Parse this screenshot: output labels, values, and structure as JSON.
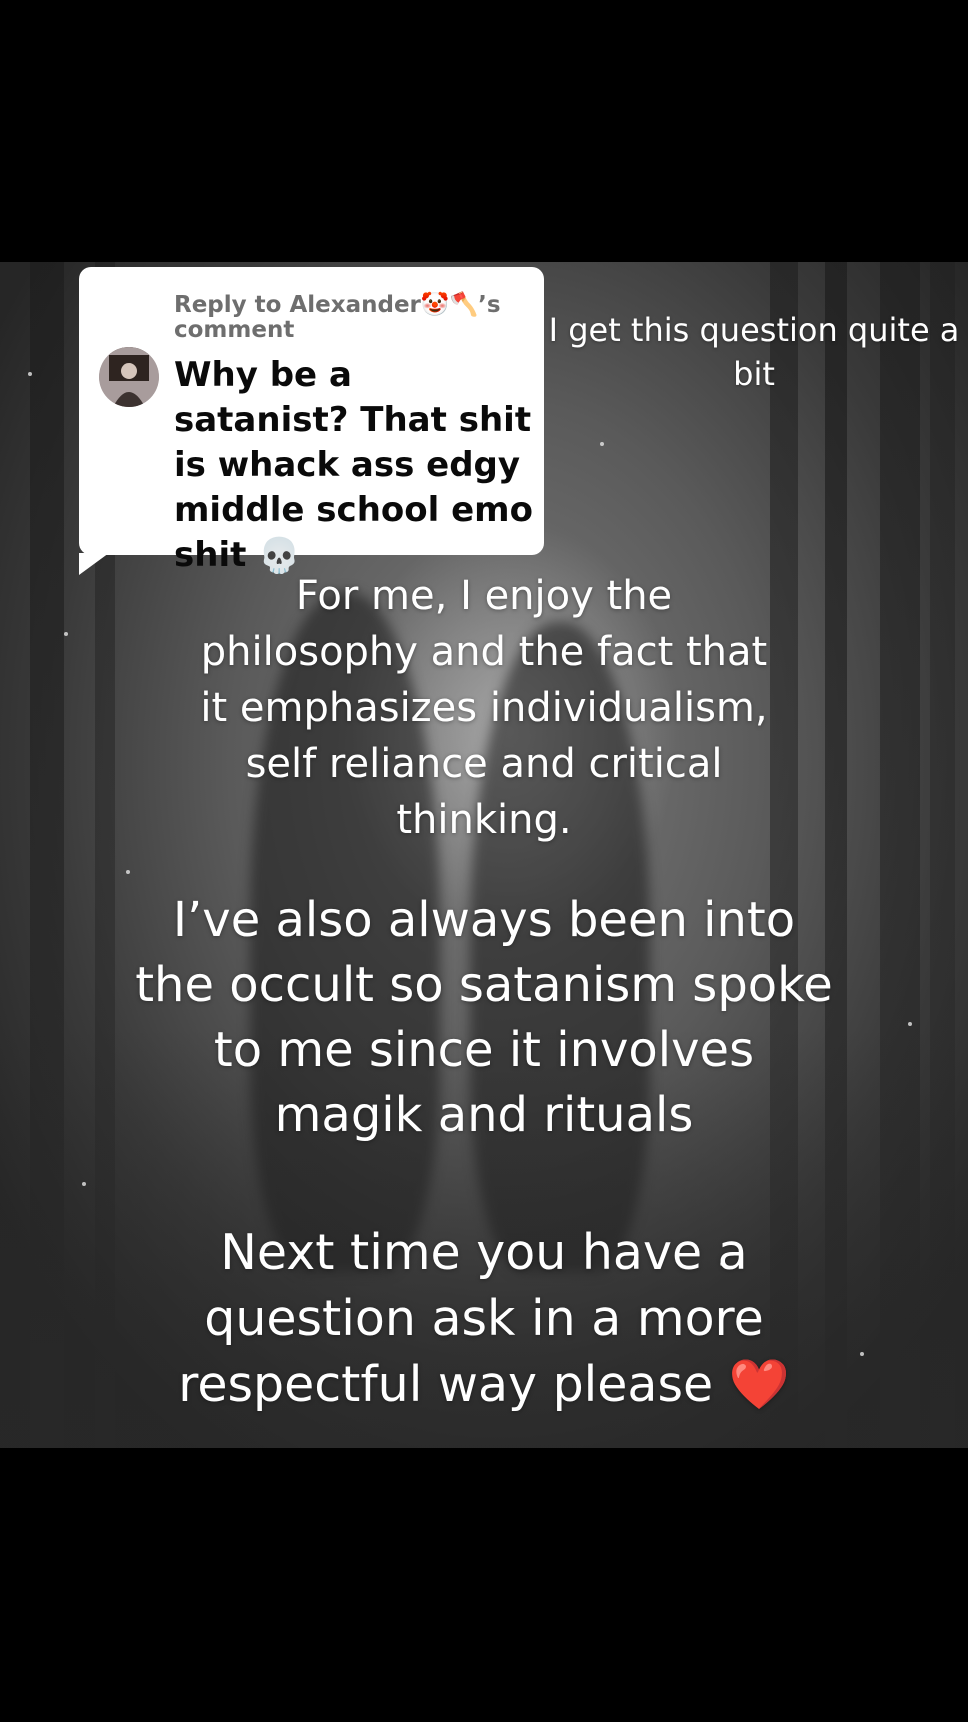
{
  "reply": {
    "header": "Reply to Alexander🤡🪓’s comment",
    "question": "Why be a satanist? That shit is whack ass edgy middle school emo shit",
    "question_emoji": "💀"
  },
  "side_note": "I get this question quite a bit",
  "paragraphs": {
    "p1": "For me, I enjoy the philosophy and the fact that it emphasizes individualism, self reliance and critical thinking.",
    "p2": "I’ve also always been into the occult so satanism spoke to me since it involves magik and rituals",
    "p3": "Next time you have a question ask in a more respectful way please",
    "p3_emoji": "❤️"
  },
  "colors": {
    "background": "#000000",
    "reply_card": "#ffffff",
    "reply_header": "#6e6e6e",
    "text": "#ffffff"
  },
  "icons": {
    "avatar": "profile-photo",
    "question_emoji": "skull-emoji",
    "closing_emoji": "red-heart-emoji"
  }
}
